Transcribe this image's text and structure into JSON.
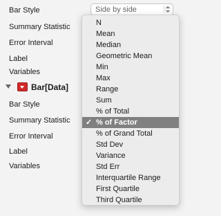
{
  "top_rows": [
    "Bar Style",
    "Summary Statistic",
    "Error Interval",
    "Label",
    "Variables"
  ],
  "bar_style_select": {
    "value": "Side by side"
  },
  "section": {
    "title": "Bar[Data]"
  },
  "bottom_rows": [
    "Bar Style",
    "Summary Statistic",
    "Error Interval",
    "Label",
    "Variables"
  ],
  "menu": {
    "items": [
      "N",
      "Mean",
      "Median",
      "Geometric Mean",
      "Min",
      "Max",
      "Range",
      "Sum",
      "% of Total",
      "% of Factor",
      "% of Grand Total",
      "Std Dev",
      "Variance",
      "Std Err",
      "Interquartile Range",
      "First Quartile",
      "Third Quartile"
    ],
    "selected": "% of Factor",
    "check_glyph": "✓"
  }
}
